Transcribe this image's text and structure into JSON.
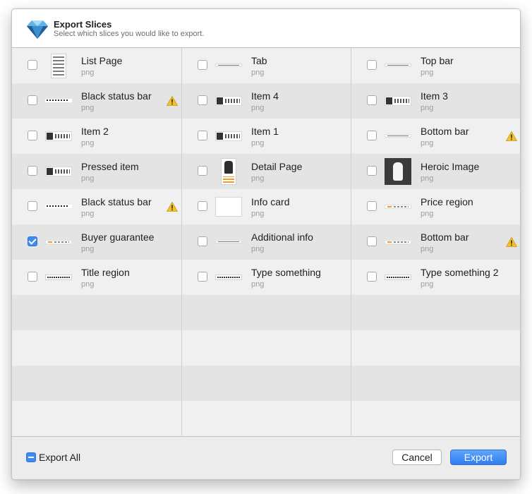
{
  "header": {
    "title": "Export Slices",
    "subtitle": "Select which slices you would like to export."
  },
  "columns": [
    {
      "items": [
        {
          "name": "List Page",
          "format": "png",
          "checked": false,
          "warning": false,
          "thumb": "page"
        },
        {
          "name": "Black status bar",
          "format": "png",
          "checked": false,
          "warning": true,
          "thumb": "dark"
        },
        {
          "name": "Item 2",
          "format": "png",
          "checked": false,
          "warning": false,
          "thumb": "item"
        },
        {
          "name": "Pressed item",
          "format": "png",
          "checked": false,
          "warning": false,
          "thumb": "item"
        },
        {
          "name": "Black status bar",
          "format": "png",
          "checked": false,
          "warning": true,
          "thumb": "dark"
        },
        {
          "name": "Buyer guarantee",
          "format": "png",
          "checked": true,
          "warning": false,
          "thumb": "orange"
        },
        {
          "name": "Title region",
          "format": "png",
          "checked": false,
          "warning": false,
          "thumb": "type"
        }
      ]
    },
    {
      "items": [
        {
          "name": "Tab",
          "format": "png",
          "checked": false,
          "warning": false,
          "thumb": "bar"
        },
        {
          "name": "Item 4",
          "format": "png",
          "checked": false,
          "warning": false,
          "thumb": "item"
        },
        {
          "name": "Item 1",
          "format": "png",
          "checked": false,
          "warning": false,
          "thumb": "item"
        },
        {
          "name": "Detail Page",
          "format": "png",
          "checked": false,
          "warning": false,
          "thumb": "detail"
        },
        {
          "name": "Info card",
          "format": "png",
          "checked": false,
          "warning": false,
          "thumb": "card"
        },
        {
          "name": "Additional info",
          "format": "png",
          "checked": false,
          "warning": false,
          "thumb": "bar"
        },
        {
          "name": "Type something",
          "format": "png",
          "checked": false,
          "warning": false,
          "thumb": "type"
        }
      ]
    },
    {
      "items": [
        {
          "name": "Top bar",
          "format": "png",
          "checked": false,
          "warning": false,
          "thumb": "bar"
        },
        {
          "name": "Item 3",
          "format": "png",
          "checked": false,
          "warning": false,
          "thumb": "item"
        },
        {
          "name": "Bottom bar",
          "format": "png",
          "checked": false,
          "warning": true,
          "thumb": "bar"
        },
        {
          "name": "Heroic Image",
          "format": "png",
          "checked": false,
          "warning": false,
          "thumb": "hero"
        },
        {
          "name": "Price region",
          "format": "png",
          "checked": false,
          "warning": false,
          "thumb": "orange"
        },
        {
          "name": "Bottom bar",
          "format": "png",
          "checked": false,
          "warning": true,
          "thumb": "orange"
        },
        {
          "name": "Type something 2",
          "format": "png",
          "checked": false,
          "warning": false,
          "thumb": "type"
        }
      ]
    }
  ],
  "footer": {
    "export_all_label": "Export All",
    "cancel_label": "Cancel",
    "export_label": "Export"
  },
  "colors": {
    "accent": "#3d8bf3",
    "warning": "#f2c12e",
    "row_light": "#f0f0f0",
    "row_dark": "#e4e4e4"
  },
  "icons": {
    "app_icon": "sketch-diamond-icon",
    "warning_icon": "warning-triangle-icon",
    "checkbox_checked": "checkmark-icon",
    "export_all_mixed": "minus-icon"
  }
}
